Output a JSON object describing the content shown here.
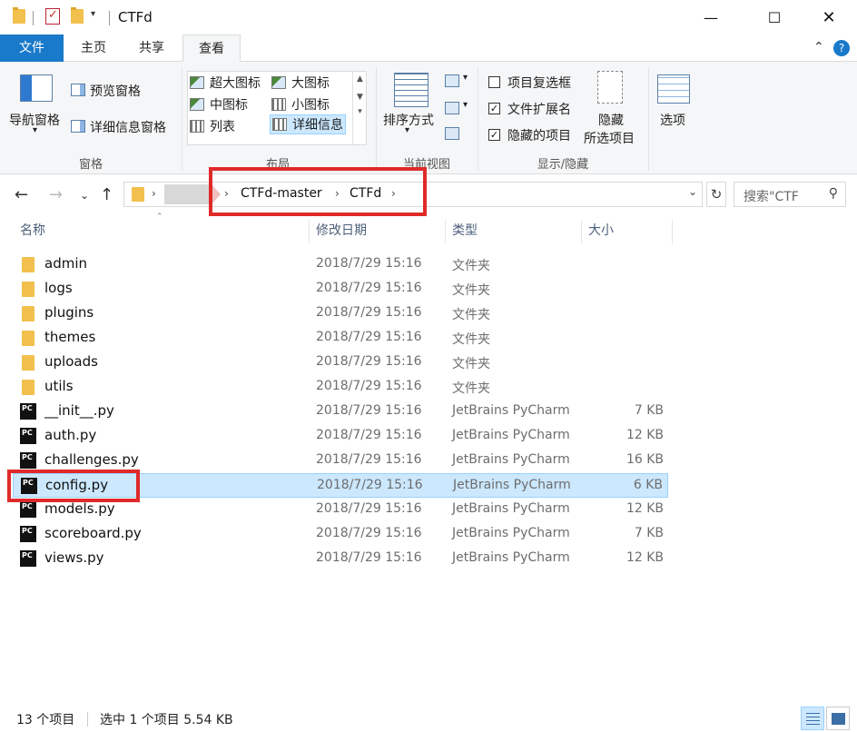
{
  "window": {
    "title": "CTFd"
  },
  "ribbon_tabs": [
    "文件",
    "主页",
    "共享",
    "查看"
  ],
  "ribbon": {
    "panes": {
      "nav_pane": "导航窗格",
      "preview_pane": "预览窗格",
      "details_pane": "详细信息窗格",
      "group_label": "窗格"
    },
    "layout": {
      "items": [
        "超大图标",
        "大图标",
        "中图标",
        "小图标",
        "列表",
        "详细信息"
      ],
      "selected": "详细信息",
      "group_label": "布局"
    },
    "current_view": {
      "sort_by": "排序方式",
      "group_label": "当前视图"
    },
    "show_hide": {
      "item_checkboxes": "项目复选框",
      "file_extensions": "文件扩展名",
      "hidden_items": "隐藏的项目",
      "item_checkboxes_checked": false,
      "file_extensions_checked": true,
      "hidden_items_checked": true,
      "hide_selected_line1": "隐藏",
      "hide_selected_line2": "所选项目",
      "group_label": "显示/隐藏"
    },
    "options": "选项"
  },
  "address": {
    "crumbs": [
      "CTFd-master",
      "CTFd"
    ],
    "search_placeholder": "搜索\"CTF"
  },
  "columns": {
    "name": "名称",
    "date": "修改日期",
    "type": "类型",
    "size": "大小"
  },
  "files": [
    {
      "name": "admin",
      "date": "2018/7/29 15:16",
      "type": "文件夹",
      "size": "",
      "kind": "folder"
    },
    {
      "name": "logs",
      "date": "2018/7/29 15:16",
      "type": "文件夹",
      "size": "",
      "kind": "folder"
    },
    {
      "name": "plugins",
      "date": "2018/7/29 15:16",
      "type": "文件夹",
      "size": "",
      "kind": "folder"
    },
    {
      "name": "themes",
      "date": "2018/7/29 15:16",
      "type": "文件夹",
      "size": "",
      "kind": "folder"
    },
    {
      "name": "uploads",
      "date": "2018/7/29 15:16",
      "type": "文件夹",
      "size": "",
      "kind": "folder"
    },
    {
      "name": "utils",
      "date": "2018/7/29 15:16",
      "type": "文件夹",
      "size": "",
      "kind": "folder"
    },
    {
      "name": "__init__.py",
      "date": "2018/7/29 15:16",
      "type": "JetBrains PyCharm",
      "size": "7 KB",
      "kind": "py"
    },
    {
      "name": "auth.py",
      "date": "2018/7/29 15:16",
      "type": "JetBrains PyCharm",
      "size": "12 KB",
      "kind": "py"
    },
    {
      "name": "challenges.py",
      "date": "2018/7/29 15:16",
      "type": "JetBrains PyCharm",
      "size": "16 KB",
      "kind": "py"
    },
    {
      "name": "config.py",
      "date": "2018/7/29 15:16",
      "type": "JetBrains PyCharm",
      "size": "6 KB",
      "kind": "py",
      "selected": true
    },
    {
      "name": "models.py",
      "date": "2018/7/29 15:16",
      "type": "JetBrains PyCharm",
      "size": "12 KB",
      "kind": "py"
    },
    {
      "name": "scoreboard.py",
      "date": "2018/7/29 15:16",
      "type": "JetBrains PyCharm",
      "size": "7 KB",
      "kind": "py"
    },
    {
      "name": "views.py",
      "date": "2018/7/29 15:16",
      "type": "JetBrains PyCharm",
      "size": "12 KB",
      "kind": "py"
    }
  ],
  "status": {
    "item_count": "13 个项目",
    "selection": "选中 1 个项目  5.54 KB"
  },
  "colors": {
    "accent": "#1979ca",
    "selection": "#cce8ff",
    "highlight_box": "#e02a2a"
  }
}
